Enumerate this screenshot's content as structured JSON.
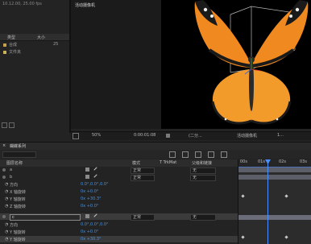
{
  "project_panel": {
    "header_date": "10.12.00, 25.00 fps",
    "col_name": "类型",
    "col_size": "大小",
    "rows": [
      {
        "label": "合成",
        "value": "25",
        "color": "#c8a24a"
      },
      {
        "label": "文件夹",
        "value": "",
        "color": "#c9b356"
      }
    ]
  },
  "composition": {
    "tab_label": "活动摄像机",
    "zoom": "50%",
    "timecode": "0:00:01:08",
    "quality": "(二分...",
    "view": "活动摄像机",
    "views_count": "1..."
  },
  "timeline": {
    "tab_label": "蝴蝶系列",
    "timecode": "",
    "columns": {
      "layer_name": "图层名称",
      "mode": "模式",
      "trkmat": "T  TrkMat",
      "parent": "父级和链接"
    },
    "ruler": [
      "00s",
      "01s",
      "02s",
      "03s"
    ],
    "layers": [
      {
        "name": "a",
        "kind": "layer",
        "mode": "正常",
        "parent": "无",
        "value": ""
      },
      {
        "name": "b",
        "kind": "layer",
        "mode": "正常",
        "parent": "无",
        "value": ""
      },
      {
        "name": "方向",
        "kind": "prop",
        "value": "0.0°,0.0°,0.0°"
      },
      {
        "name": "X 轴旋转",
        "kind": "prop",
        "value": "0x +0.0°"
      },
      {
        "name": "Y 轴旋转",
        "kind": "prop",
        "value": "0x +30.3°"
      },
      {
        "name": "Z 轴旋转",
        "kind": "prop",
        "value": "0x +0.0°"
      },
      {
        "name": "c",
        "kind": "layer",
        "mode": "正常",
        "parent": "无",
        "value": ""
      },
      {
        "name": "方向",
        "kind": "prop",
        "value": "0.0°,0.0°,0.0°"
      },
      {
        "name": "Y 轴旋转",
        "kind": "prop",
        "value": "0x +0.0°"
      },
      {
        "name": "Y 轴旋转",
        "kind": "prop",
        "value": "0x +30.3°"
      }
    ]
  }
}
